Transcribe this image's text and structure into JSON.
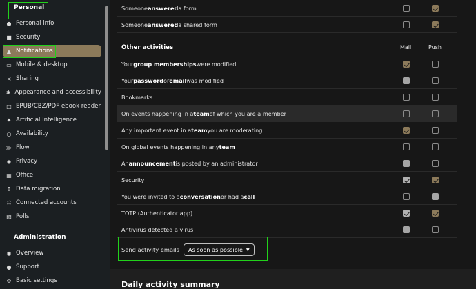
{
  "sidebar": {
    "personal_heading": "Personal",
    "admin_heading": "Administration",
    "personal_items": [
      {
        "label": "Personal info",
        "icon": "person-icon"
      },
      {
        "label": "Security",
        "icon": "lock-icon"
      },
      {
        "label": "Notifications",
        "icon": "bell-icon",
        "active": true
      },
      {
        "label": "Mobile & desktop",
        "icon": "monitor-icon"
      },
      {
        "label": "Sharing",
        "icon": "share-icon"
      },
      {
        "label": "Appearance and accessibility",
        "icon": "accessibility-icon"
      },
      {
        "label": "EPUB/CBZ/PDF ebook reader",
        "icon": "book-icon"
      },
      {
        "label": "Artificial Intelligence",
        "icon": "sparkle-icon"
      },
      {
        "label": "Availability",
        "icon": "clock-icon"
      },
      {
        "label": "Flow",
        "icon": "flow-icon"
      },
      {
        "label": "Privacy",
        "icon": "key-icon"
      },
      {
        "label": "Office",
        "icon": "office-icon"
      },
      {
        "label": "Data migration",
        "icon": "download-icon"
      },
      {
        "label": "Connected accounts",
        "icon": "plug-icon"
      },
      {
        "label": "Polls",
        "icon": "poll-icon"
      }
    ],
    "admin_items": [
      {
        "label": "Overview",
        "icon": "overview-icon"
      },
      {
        "label": "Support",
        "icon": "chat-icon"
      },
      {
        "label": "Basic settings",
        "icon": "gear-icon"
      }
    ]
  },
  "main": {
    "top_rows": [
      {
        "pre": "Someone ",
        "bold": "answered",
        "post": " a form",
        "bold2": "",
        "post2": "",
        "mail": false,
        "push": true
      },
      {
        "pre": "Someone ",
        "bold": "answered",
        "post": " a shared form",
        "bold2": "",
        "post2": "",
        "mail": false,
        "push": true
      }
    ],
    "other_heading": "Other activities",
    "col_mail": "Mail",
    "col_push": "Push",
    "rows": [
      {
        "pre": "Your ",
        "bold": "group memberships",
        "post": " were modified",
        "bold2": "",
        "post2": "",
        "mail": "checked",
        "push": "unchecked"
      },
      {
        "pre": "Your ",
        "bold": "password",
        "post": " or ",
        "bold2": "email",
        "post2": " was modified",
        "mail": "disabled",
        "push": "unchecked"
      },
      {
        "pre": "Bookmarks",
        "bold": "",
        "post": "",
        "bold2": "",
        "post2": "",
        "mail": "unchecked",
        "push": "unchecked"
      },
      {
        "pre": "On events happening in a ",
        "bold": "team",
        "post": " of which you are a member",
        "bold2": "",
        "post2": "",
        "mail": "unchecked",
        "push": "unchecked"
      },
      {
        "pre": "Any important event in a ",
        "bold": "team",
        "post": " you are moderating",
        "bold2": "",
        "post2": "",
        "mail": "checked",
        "push": "unchecked"
      },
      {
        "pre": "On global events happening in any ",
        "bold": "team",
        "post": "",
        "bold2": "",
        "post2": "",
        "mail": "unchecked",
        "push": "unchecked"
      },
      {
        "pre": "An ",
        "bold": "announcement",
        "post": " is posted by an administrator",
        "bold2": "",
        "post2": "",
        "mail": "disabled",
        "push": "unchecked"
      },
      {
        "pre": "Security",
        "bold": "",
        "post": "",
        "bold2": "",
        "post2": "",
        "mail": "disabled-checked",
        "push": "checked"
      },
      {
        "pre": "You were invited to a ",
        "bold": "conversation",
        "post": " or had a ",
        "bold2": "call",
        "post2": "",
        "mail": "unchecked",
        "push": "disabled"
      },
      {
        "pre": "TOTP (Authenticator app)",
        "bold": "",
        "post": "",
        "bold2": "",
        "post2": "",
        "mail": "disabled-checked",
        "push": "checked"
      },
      {
        "pre": "Antivirus detected a virus",
        "bold": "",
        "post": "",
        "bold2": "",
        "post2": "",
        "mail": "disabled",
        "push": "unchecked"
      }
    ],
    "send_label": "Send activity emails",
    "send_value": "As soon as possible",
    "daily_heading": "Daily activity summary"
  },
  "colors": {
    "accent": "#8c7a5a",
    "highlight": "#22d11b",
    "sidebar_bg": "#1b1f22",
    "main_bg": "#171717"
  }
}
